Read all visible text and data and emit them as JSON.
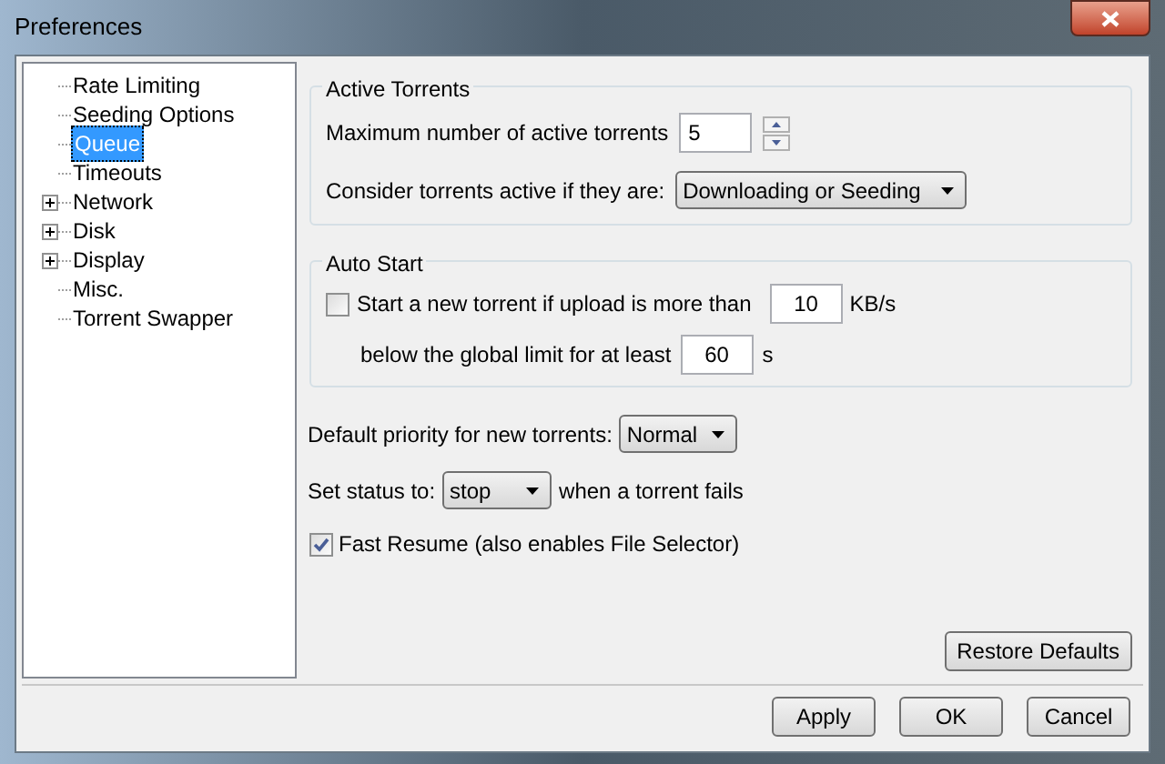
{
  "window": {
    "title": "Preferences"
  },
  "sidebar": {
    "items": [
      {
        "label": "Rate Limiting",
        "selected": false
      },
      {
        "label": "Seeding Options",
        "selected": false
      },
      {
        "label": "Queue",
        "selected": true
      },
      {
        "label": "Timeouts",
        "selected": false
      },
      {
        "label": "Network",
        "selected": false,
        "expanded": false
      },
      {
        "label": "Disk",
        "selected": false,
        "expanded": false
      },
      {
        "label": "Display",
        "selected": false,
        "expanded": false
      },
      {
        "label": "Misc.",
        "selected": false
      },
      {
        "label": "Torrent Swapper",
        "selected": false
      }
    ]
  },
  "active_torrents": {
    "title": "Active Torrents",
    "max_label": "Maximum number of active torrents",
    "max_value": "5",
    "consider_label": "Consider torrents active if they are:",
    "consider_value": "Downloading or Seeding"
  },
  "auto_start": {
    "title": "Auto Start",
    "checked": false,
    "upload_label": "Start a new torrent if upload is more than",
    "upload_value": "10",
    "upload_unit": "KB/s",
    "below_label": "below the global limit for at least",
    "below_value": "60",
    "below_unit": "s"
  },
  "priority": {
    "label": "Default priority for new torrents:",
    "value": "Normal"
  },
  "status": {
    "label": "Set status to:",
    "value": "stop",
    "suffix": "when a torrent fails"
  },
  "fast_resume": {
    "label": "Fast Resume (also enables File Selector)",
    "checked": true
  },
  "restore_button": "Restore Defaults",
  "buttons": [
    "Apply",
    "OK",
    "Cancel"
  ]
}
